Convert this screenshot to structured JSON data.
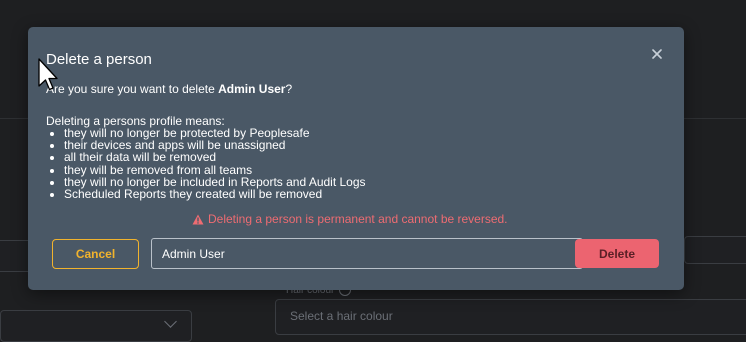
{
  "background": {
    "hair_label": "Hair colour",
    "hair_placeholder": "Select a hair colour"
  },
  "dialog": {
    "title": "Delete a person",
    "question_prefix": "Are you sure you want to delete ",
    "person_name": "Admin User",
    "question_suffix": "?",
    "intro": "Deleting a persons profile means:",
    "consequences": [
      "they will no longer be protected by Peoplesafe",
      "their devices and apps will be unassigned",
      "all their data will be removed",
      "they will be removed from all teams",
      "they will no longer be included in Reports and Audit Logs",
      "Scheduled Reports they created will be removed"
    ],
    "warning": "Deleting a person is permanent and cannot be reversed.",
    "cancel_label": "Cancel",
    "confirm_input_value": "Admin User",
    "delete_label": "Delete"
  },
  "colors": {
    "modal_bg": "#4a5866",
    "accent_cancel": "#f1b32d",
    "danger": "#ec6470",
    "warning_text": "#ee6c72"
  },
  "icons": {
    "close": "close-icon",
    "warning": "warning-triangle-icon",
    "help": "help-circle-icon",
    "chevron": "chevron-down-icon",
    "cursor": "mouse-cursor-icon"
  }
}
